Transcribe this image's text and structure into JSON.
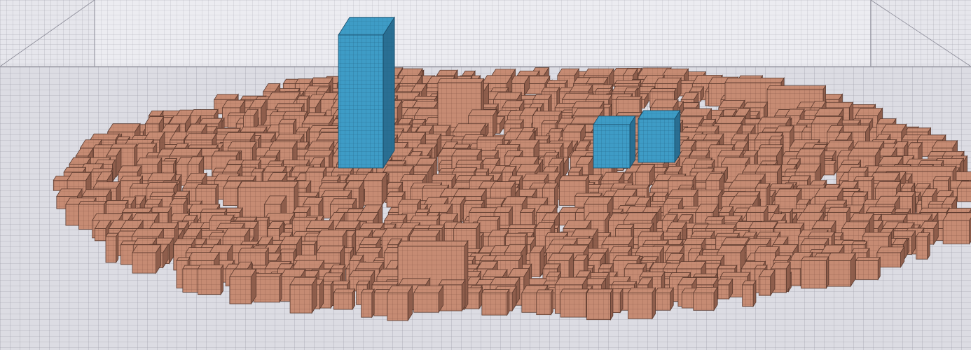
{
  "scene": {
    "kind": "3d-urban-mesh-render",
    "colors": {
      "background": "#e9e9ee",
      "domain_wall": "#e4e4ea",
      "ground": "#dcdce3",
      "mesh_line": "#8a8a96",
      "building_fill": "#c68b73",
      "building_dark": "#8f5e4c",
      "building_edge": "#5b3a2e",
      "highlight_fill": "#3e9cc6",
      "highlight_dark": "#2a6f93",
      "highlight_edge": "#184a66"
    },
    "highlighted_buildings": [
      {
        "id": "tall-tower"
      },
      {
        "id": "tower-b-left"
      },
      {
        "id": "tower-b-right"
      }
    ]
  }
}
